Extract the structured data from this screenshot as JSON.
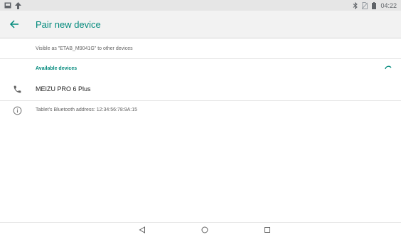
{
  "status_bar": {
    "left_icons": [
      "image-notification-icon",
      "upload-notification-icon"
    ],
    "right_icons": [
      "bluetooth-icon",
      "no-sim-icon",
      "battery-icon"
    ],
    "time": "04:22"
  },
  "app_bar": {
    "title": "Pair new device",
    "back_icon": "arrow-back-icon"
  },
  "visibility_text": "Visible as \"ETAB_M9041G\" to other devices",
  "available_section": {
    "header": "Available devices",
    "scanning_icon": "progress-spinner-icon"
  },
  "devices": [
    {
      "name": "MEIZU PRO 6 Plus",
      "icon": "phone-icon"
    }
  ],
  "bt_address_text": "Tablet's Bluetooth address: 12:34:56:78:9A:15",
  "nav_bar": {
    "buttons": [
      "back-triangle-icon",
      "home-circle-icon",
      "recents-square-icon"
    ]
  },
  "colors": {
    "accent": "#00897b",
    "app_bar_bg": "#f2f2f2",
    "status_bar_bg": "#e6e6e6"
  }
}
